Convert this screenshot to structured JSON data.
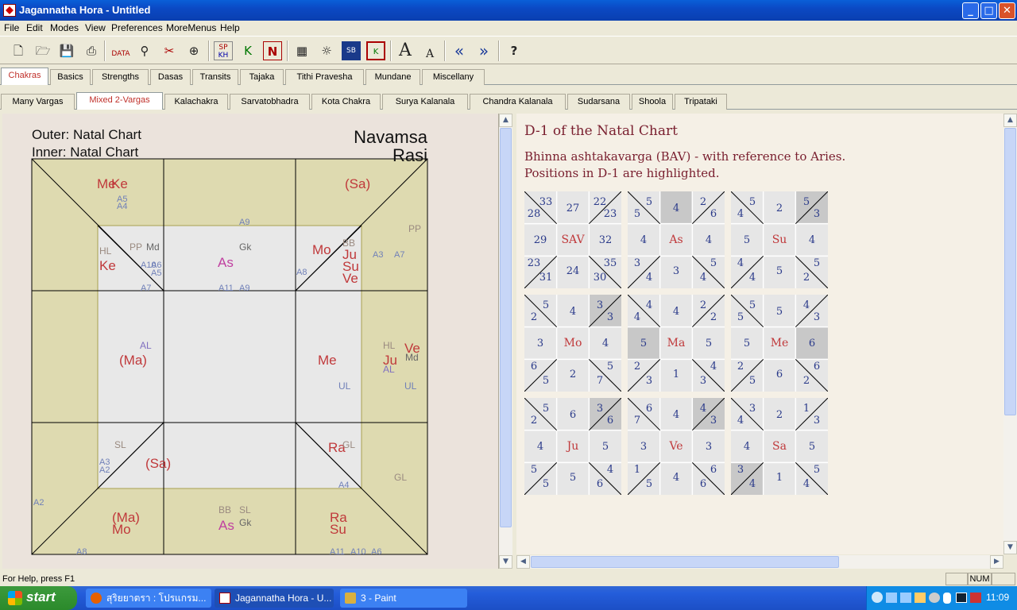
{
  "window": {
    "title": "Jagannatha Hora - Untitled"
  },
  "menu": [
    "File",
    "Edit",
    "Modes",
    "View",
    "Preferences",
    "MoreMenus",
    "Help"
  ],
  "toolbar_icons": [
    "new-icon",
    "open-icon",
    "save-icon",
    "print-icon",
    "data-icon",
    "transit-icon",
    "chart-remove-icon",
    "compass-icon",
    "sp-kh-icon",
    "arrow-k-icon",
    "n-icon",
    "grid-icon",
    "sun-icon",
    "sb-icon",
    "k-icon",
    "font-larger-icon",
    "font-smaller-icon",
    "previous-icon",
    "next-icon",
    "help-icon"
  ],
  "toolbar_labels": {
    "data": "DATA",
    "sp": "SP",
    "kh": "KH",
    "n": "N",
    "k": "K",
    "sb": "SB",
    "font_large": "A",
    "font_small": "A",
    "help": "?"
  },
  "tabs_main": [
    "Chakras",
    "Basics",
    "Strengths",
    "Dasas",
    "Transits",
    "Tajaka",
    "Tithi Pravesha",
    "Mundane",
    "Miscellany"
  ],
  "tabs_sub": [
    "Many Vargas",
    "Mixed 2-Vargas",
    "Kalachakra",
    "Sarvatobhadra",
    "Kota Chakra",
    "Surya Kalanala",
    "Chandra Kalanala",
    "Sudarsana",
    "Shoola",
    "Tripataki"
  ],
  "chart": {
    "outer_label": "Outer: Natal Chart",
    "inner_label": "Inner: Natal Chart",
    "outer_varga": "Navamsa",
    "inner_varga": "Rasi",
    "labels": [
      {
        "t": "Me",
        "c": "#c0393b",
        "s": 17
      },
      {
        "t": "Ke",
        "c": "#c0393b",
        "s": 17
      },
      {
        "t": "A5",
        "c": "#7080b8",
        "s": 11
      },
      {
        "t": "A4",
        "c": "#7080b8",
        "s": 11
      },
      {
        "t": "(Sa)",
        "c": "#c0393b",
        "s": 17
      },
      {
        "t": "PP",
        "c": "#9a8a80",
        "s": 12
      },
      {
        "t": "A9",
        "c": "#7080b8",
        "s": 11
      },
      {
        "t": "HL",
        "c": "#9a8a80",
        "s": 12
      },
      {
        "t": "Ke",
        "c": "#c0393b",
        "s": 17
      },
      {
        "t": "PP",
        "c": "#9a8a80",
        "s": 12
      },
      {
        "t": "Md",
        "c": "#666",
        "s": 12
      },
      {
        "t": "A10",
        "c": "#7080b8",
        "s": 11
      },
      {
        "t": "A6",
        "c": "#7080b8",
        "s": 11
      },
      {
        "t": "A5",
        "c": "#7080b8",
        "s": 11
      },
      {
        "t": "A7",
        "c": "#7080b8",
        "s": 11
      },
      {
        "t": "As",
        "c": "#c040a0",
        "s": 17
      },
      {
        "t": "Gk",
        "c": "#666",
        "s": 12
      },
      {
        "t": "A11",
        "c": "#7080b8",
        "s": 11
      },
      {
        "t": "A9",
        "c": "#7080b8",
        "s": 11
      },
      {
        "t": "Mo",
        "c": "#c0393b",
        "s": 17
      },
      {
        "t": "BB",
        "c": "#9a8a80",
        "s": 12
      },
      {
        "t": "Ju",
        "c": "#c0393b",
        "s": 17
      },
      {
        "t": "Su",
        "c": "#c0393b",
        "s": 17
      },
      {
        "t": "Ve",
        "c": "#c0393b",
        "s": 17
      },
      {
        "t": "A8",
        "c": "#7080b8",
        "s": 11
      },
      {
        "t": "A3",
        "c": "#7080b8",
        "s": 11
      },
      {
        "t": "A7",
        "c": "#7080b8",
        "s": 11
      },
      {
        "t": "AL",
        "c": "#8070c0",
        "s": 12
      },
      {
        "t": "(Ma)",
        "c": "#c0393b",
        "s": 17
      },
      {
        "t": "Me",
        "c": "#c0393b",
        "s": 17
      },
      {
        "t": "UL",
        "c": "#7080b8",
        "s": 12
      },
      {
        "t": "HL",
        "c": "#9a8a80",
        "s": 12
      },
      {
        "t": "Ve",
        "c": "#c0393b",
        "s": 17
      },
      {
        "t": "Ju",
        "c": "#c0393b",
        "s": 17
      },
      {
        "t": "Md",
        "c": "#666",
        "s": 12
      },
      {
        "t": "AL",
        "c": "#8070c0",
        "s": 12
      },
      {
        "t": "UL",
        "c": "#7080b8",
        "s": 12
      },
      {
        "t": "SL",
        "c": "#9a8a80",
        "s": 12
      },
      {
        "t": "A3",
        "c": "#7080b8",
        "s": 11
      },
      {
        "t": "A2",
        "c": "#7080b8",
        "s": 11
      },
      {
        "t": "(Sa)",
        "c": "#c0393b",
        "s": 17
      },
      {
        "t": "Ra",
        "c": "#c0393b",
        "s": 17
      },
      {
        "t": "GL",
        "c": "#9a8a80",
        "s": 12
      },
      {
        "t": "A4",
        "c": "#7080b8",
        "s": 11
      },
      {
        "t": "GL",
        "c": "#9a8a80",
        "s": 12
      },
      {
        "t": "A2",
        "c": "#7080b8",
        "s": 11
      },
      {
        "t": "(Ma)",
        "c": "#c0393b",
        "s": 17
      },
      {
        "t": "Mo",
        "c": "#c0393b",
        "s": 17
      },
      {
        "t": "BB",
        "c": "#9a8a80",
        "s": 12
      },
      {
        "t": "SL",
        "c": "#9a8a80",
        "s": 12
      },
      {
        "t": "As",
        "c": "#c040a0",
        "s": 17
      },
      {
        "t": "Gk",
        "c": "#666",
        "s": 12
      },
      {
        "t": "Ra",
        "c": "#c0393b",
        "s": 17
      },
      {
        "t": "Su",
        "c": "#c0393b",
        "s": 17
      },
      {
        "t": "A8",
        "c": "#7080b8",
        "s": 11
      },
      {
        "t": "A11",
        "c": "#7080b8",
        "s": 11
      },
      {
        "t": "A10",
        "c": "#7080b8",
        "s": 11
      },
      {
        "t": "A6",
        "c": "#7080b8",
        "s": 11
      }
    ]
  },
  "right": {
    "title": "D-1 of the Natal Chart",
    "subtitle1": "Bhinna ashtakavarga (BAV) - with reference to Aries.",
    "subtitle2": "Positions in D-1 are highlighted.",
    "bav_tables": [
      {
        "center": "SAV",
        "top": [
          "33",
          "28",
          "27",
          "22",
          "23"
        ],
        "mid": [
          "29",
          "32"
        ],
        "bot": [
          "23",
          "31",
          "24",
          "35",
          "30"
        ],
        "hl": []
      },
      {
        "center": "As",
        "top": [
          "5",
          "5",
          "4",
          "2",
          "6"
        ],
        "mid": [
          "4",
          "4"
        ],
        "bot": [
          "3",
          "4",
          "3",
          "5",
          "4"
        ],
        "hl": [
          "t2"
        ]
      },
      {
        "center": "Su",
        "top": [
          "5",
          "4",
          "2",
          "5",
          "3"
        ],
        "mid": [
          "5",
          "4"
        ],
        "bot": [
          "4",
          "4",
          "5",
          "5",
          "2"
        ],
        "hl": [
          "t5"
        ]
      },
      {
        "center": "Mo",
        "top": [
          "5",
          "2",
          "4",
          "3",
          "3"
        ],
        "mid": [
          "3",
          "4"
        ],
        "bot": [
          "6",
          "5",
          "2",
          "5",
          "7"
        ],
        "hl": [
          "t5"
        ]
      },
      {
        "center": "Ma",
        "top": [
          "4",
          "4",
          "4",
          "2",
          "2"
        ],
        "mid": [
          "5",
          "5"
        ],
        "bot": [
          "2",
          "3",
          "1",
          "4",
          "3"
        ],
        "hl": [
          "m1"
        ]
      },
      {
        "center": "Me",
        "top": [
          "5",
          "5",
          "5",
          "4",
          "3"
        ],
        "mid": [
          "5",
          "6"
        ],
        "bot": [
          "2",
          "5",
          "6",
          "6",
          "2"
        ],
        "hl": [
          "m2"
        ]
      },
      {
        "center": "Ju",
        "top": [
          "5",
          "2",
          "6",
          "3",
          "6"
        ],
        "mid": [
          "4",
          "5"
        ],
        "bot": [
          "5",
          "5",
          "5",
          "4",
          "6"
        ],
        "hl": [
          "t5"
        ]
      },
      {
        "center": "Ve",
        "top": [
          "6",
          "7",
          "4",
          "4",
          "3"
        ],
        "mid": [
          "3",
          "3"
        ],
        "bot": [
          "1",
          "5",
          "4",
          "6",
          "6"
        ],
        "hl": [
          "t5"
        ]
      },
      {
        "center": "Sa",
        "top": [
          "3",
          "4",
          "2",
          "1",
          "3"
        ],
        "mid": [
          "4",
          "5"
        ],
        "bot": [
          "3",
          "4",
          "1",
          "5",
          "4"
        ],
        "hl": [
          "b1"
        ]
      }
    ]
  },
  "status": {
    "help": "For Help, press F1",
    "num": "NUM"
  },
  "taskbar": {
    "start": "start",
    "items": [
      "สุริยยาตรา : โปรแกรม...",
      "Jagannatha Hora - U...",
      "3 - Paint"
    ],
    "clock": "11:09"
  }
}
